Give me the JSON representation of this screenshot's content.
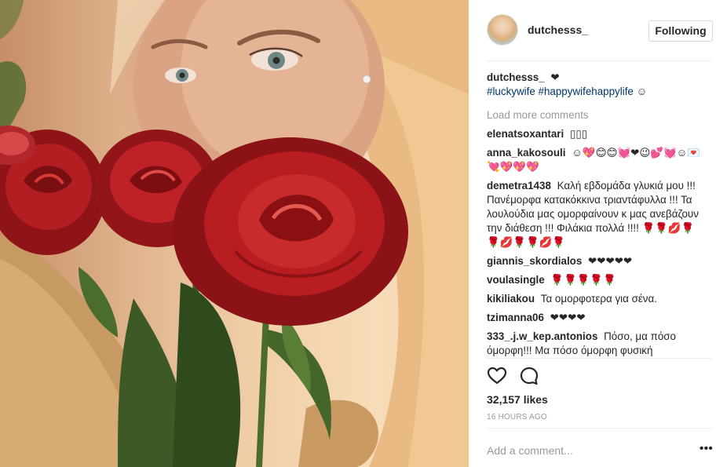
{
  "post": {
    "image_alt": "Selfie of a woman with a bouquet of red roses"
  },
  "header": {
    "username": "dutchesss_",
    "follow_button": "Following"
  },
  "caption": {
    "username": "dutchesss_",
    "text": "❤",
    "hashtag1": "#luckywife",
    "hashtag2": "#happywifehappylife",
    "emoji": "☺"
  },
  "load_more": "Load more comments",
  "comments": [
    {
      "user": "elenatsoxantari",
      "text": "▯▯▯"
    },
    {
      "user": "anna_kakosouli",
      "text": "☺💖😊😊💓❤😉💕💓☺💌💘💖💖💖"
    },
    {
      "user": "demetra1438",
      "text": "Καλή εβδομάδα γλυκιά μου !!! Πανέμορφα κατακόκκινα τριαντάφυλλα !!! Τα λουλούδια μας ομορφαίνουν κ μας ανεβάζουν την διάθεση !!! Φιλάκια πολλά !!!! 🌹🌹💋🌹🌹💋🌹🌹💋🌹"
    },
    {
      "user": "giannis_skordialos",
      "text": "❤❤❤❤❤"
    },
    {
      "user": "voulasingle",
      "text": "🌹🌹🌹🌹🌹"
    },
    {
      "user": "kikiliakou",
      "text": "Τα ομορφοτερα για σένα."
    },
    {
      "user": "tzimanna06",
      "text": "❤❤❤❤"
    },
    {
      "user": "333_.j.w_kep.antonios",
      "text": "Πόσο, μα πόσο όμορφη!!! Μα πόσο όμορφη φυσική"
    }
  ],
  "icons": {
    "like": "heart-icon",
    "comment": "comment-icon",
    "more": "ellipsis-icon"
  },
  "likes": "32,157 likes",
  "timestamp": "16 HOURS AGO",
  "add_comment": {
    "placeholder": "Add a comment..."
  },
  "more_label": "•••"
}
